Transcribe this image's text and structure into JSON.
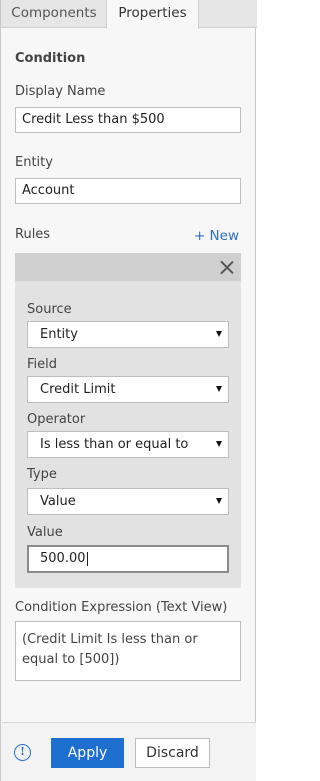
{
  "tabs": {
    "components": "Components",
    "properties": "Properties"
  },
  "section_title": "Condition",
  "display_name": {
    "label": "Display Name",
    "value": "Credit Less than $500"
  },
  "entity": {
    "label": "Entity",
    "value": "Account"
  },
  "rules": {
    "label": "Rules",
    "new_link": "+ New",
    "source": {
      "label": "Source",
      "value": "Entity"
    },
    "field": {
      "label": "Field",
      "value": "Credit Limit"
    },
    "operator": {
      "label": "Operator",
      "value": "Is less than or equal to"
    },
    "type": {
      "label": "Type",
      "value": "Value"
    },
    "value": {
      "label": "Value",
      "value": "500.00"
    }
  },
  "expression": {
    "label": "Condition Expression (Text View)",
    "text": "(Credit Limit Is less than or equal to [500])"
  },
  "footer": {
    "info_icon": "info-icon",
    "apply": "Apply",
    "discard": "Discard"
  },
  "colors": {
    "accent": "#1f6fd0",
    "link": "#2b6fc7"
  }
}
